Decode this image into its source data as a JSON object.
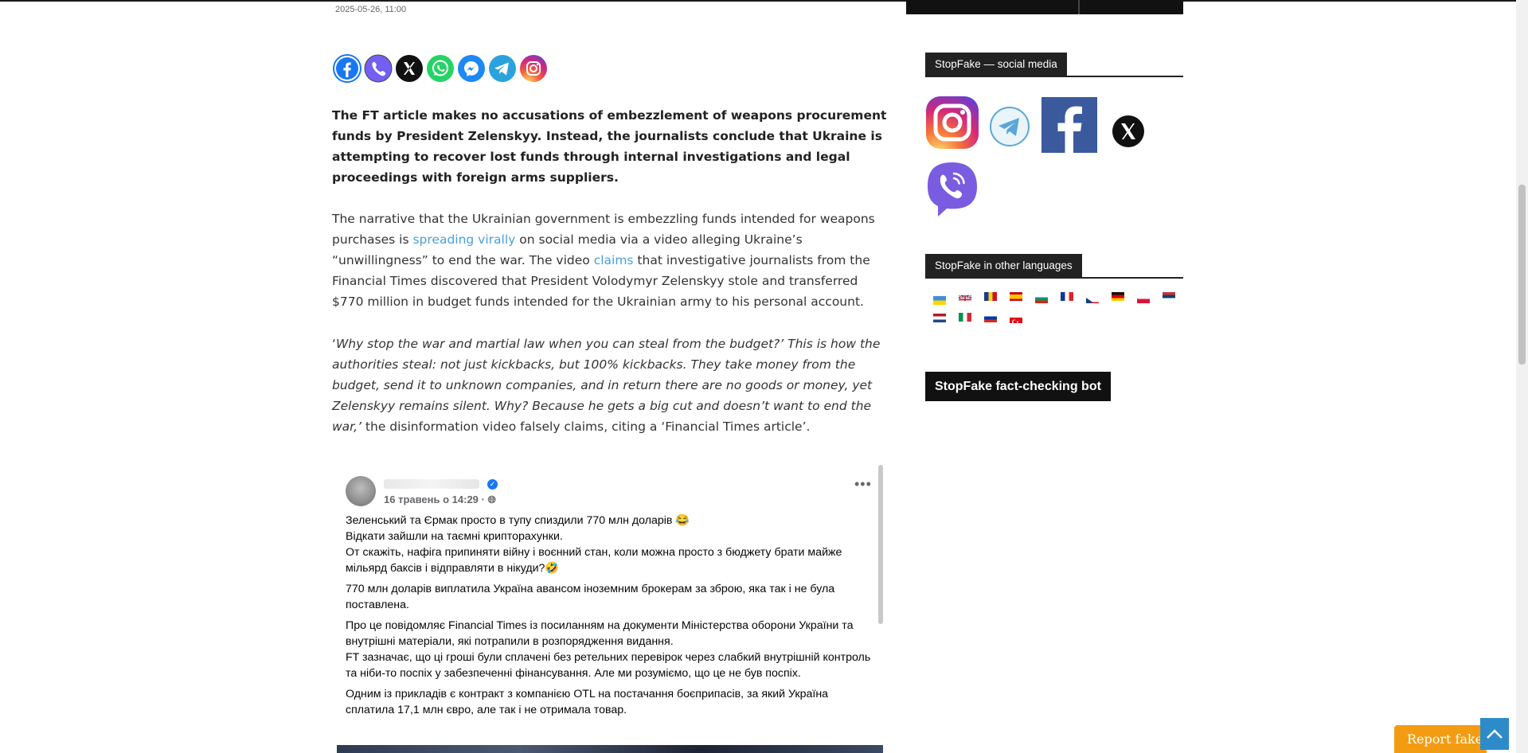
{
  "article": {
    "date": "2025-05-26, 11:00",
    "lead": "The FT article makes no accusations of embezzlement of weapons procurement funds by President Zelenskyy. Instead, the journalists conclude that Ukraine is attempting to recover lost funds through internal investigations and legal proceedings with foreign arms suppliers.",
    "p1": {
      "t1": "The narrative that the Ukrainian government is embezzling funds intended for weapons purchases is ",
      "link1": "spreading virally",
      "t2": " on social media via a video alleging Ukraine’s “unwillingness” to end the war. The video ",
      "link2": "claims",
      "t3": " that investigative journalists from the Financial Times discovered that President Volodymyr Zelenskyy stole and transferred $770 million in budget funds intended for the Ukrainian army to his personal account."
    },
    "p2": {
      "open": "‘",
      "quote": "Why stop the war and martial law when you can steal from the budget?’ This is how the authorities steal: not just kickbacks, but 100% kickbacks. They take money from the budget, send it to unknown companies, and in return there are no goods or money, yet Zelenskyy remains silent. Why? Because he gets a big cut and doesn’t want to end the war,’",
      "rest": " the disinformation video falsely claims, citing a ‘Financial Times article’."
    }
  },
  "share": [
    "facebook-icon",
    "viber-icon",
    "x-icon",
    "whatsapp-icon",
    "messenger-icon",
    "telegram-icon",
    "instagram-icon"
  ],
  "embed": {
    "meta": "16 травень о 14:29 · ",
    "lines": [
      "Зеленський та Єрмак просто в тупу спиздили 770 млн доларів 😂",
      "Відкати зайшли на таємні крипторахунки.",
      "От скажіть, нафіга припиняти війну і воєнний стан, коли можна просто з бюджету брати майже мільярд баксів і відправляти в нікуди?🤣",
      "770 млн доларів виплатила Україна авансом іноземним брокерам за зброю, яка так і не була поставлена.",
      "Про це повідомляє Financial Times із посиланням на документи Міністерства оборони України та внутрішні матеріали, які потрапили в розпорядження видання.",
      "FT зазначає, що ці гроші були сплачені без ретельних перевірок через слабкий внутрішній контроль та ніби-то поспіх у забезпеченні фінансування. Але ми розуміємо, що це не був поспіх.",
      "Одним із прикладів є контракт з компанією OTL на постачання боєприпасів, за який Україна сплатила 17,1 млн євро, але так і не отримала товар."
    ]
  },
  "sidebar": {
    "social_title": "StopFake — social media",
    "languages_title": "StopFake in other languages",
    "bot_label": "StopFake fact-checking bot",
    "social_icons": [
      "instagram-icon",
      "telegram-icon",
      "facebook-icon",
      "x-icon",
      "viber-icon"
    ],
    "flags": [
      "ukraine",
      "united-kingdom",
      "romania",
      "spain",
      "bulgaria",
      "france",
      "czech-republic",
      "germany",
      "poland",
      "serbia",
      "netherlands",
      "italy",
      "russia",
      "turkey"
    ]
  },
  "floating": {
    "report_label": "Report fake",
    "to_top_icon": "arrow-up-icon"
  },
  "colors": {
    "link": "#4a9fd8",
    "report": "#f39c12",
    "to_top": "#2e8bc9",
    "widget_title": "#222222"
  }
}
